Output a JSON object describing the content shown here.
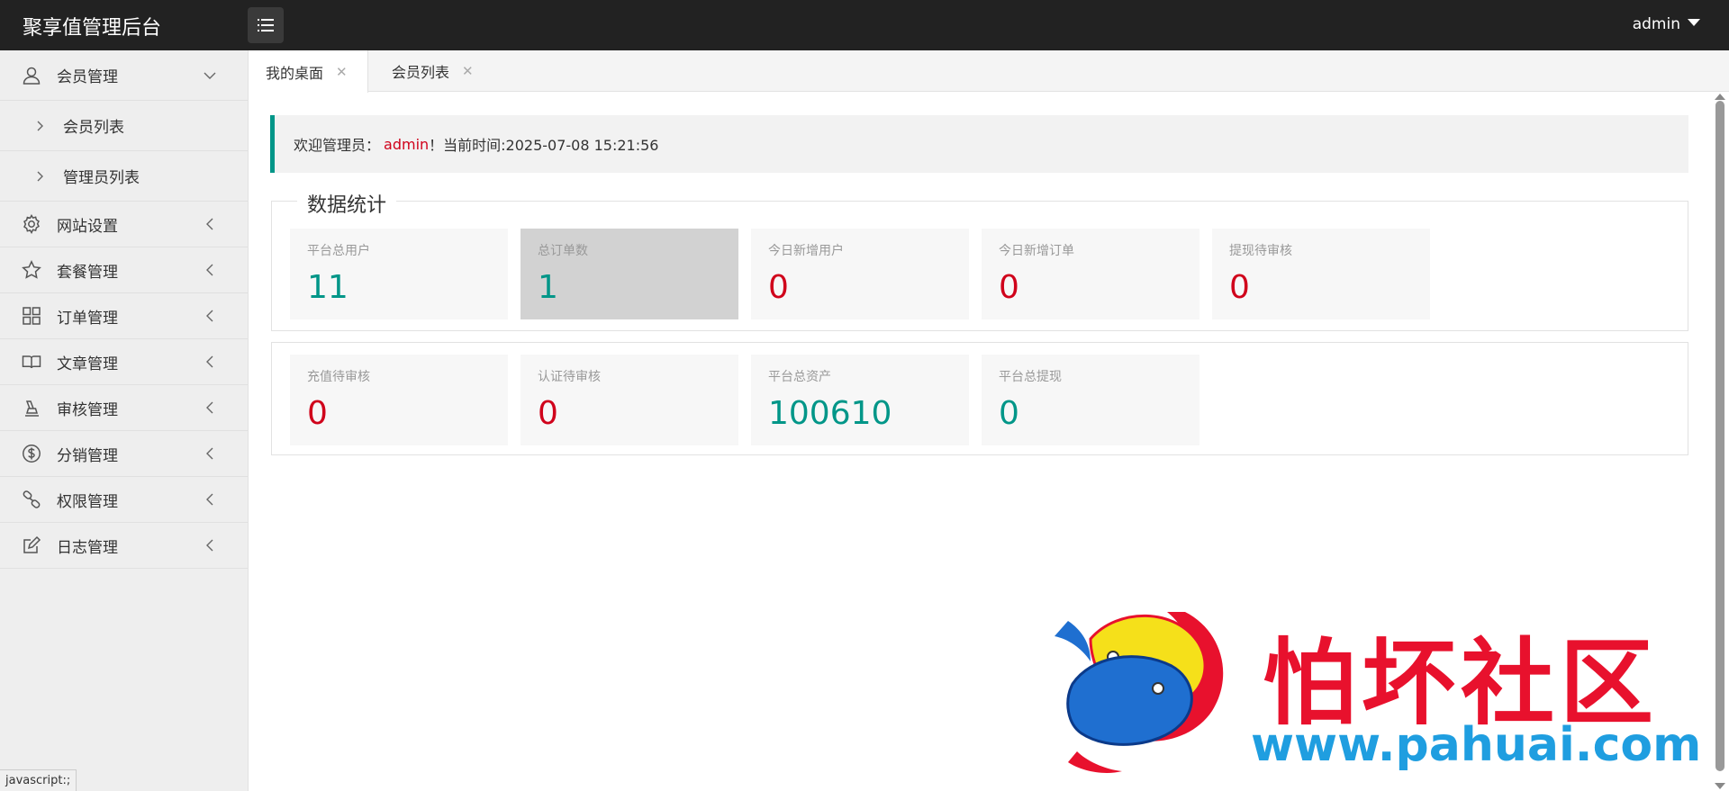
{
  "app": {
    "title": "聚享值管理后台",
    "user": "admin"
  },
  "sidebar": {
    "groups": [
      {
        "label": "会员管理",
        "icon": "user-icon",
        "expanded": true,
        "children": [
          {
            "label": "会员列表"
          },
          {
            "label": "管理员列表"
          }
        ]
      },
      {
        "label": "网站设置",
        "icon": "gear-icon"
      },
      {
        "label": "套餐管理",
        "icon": "star-icon"
      },
      {
        "label": "订单管理",
        "icon": "grid-icon"
      },
      {
        "label": "文章管理",
        "icon": "book-icon"
      },
      {
        "label": "审核管理",
        "icon": "stamp-icon"
      },
      {
        "label": "分销管理",
        "icon": "dollar-icon"
      },
      {
        "label": "权限管理",
        "icon": "link-icon"
      },
      {
        "label": "日志管理",
        "icon": "edit-icon"
      }
    ]
  },
  "tabs": [
    {
      "label": "我的桌面",
      "active": true,
      "close": "✕"
    },
    {
      "label": "会员列表",
      "active": false,
      "close": "✕"
    }
  ],
  "welcome": {
    "prefix": "欢迎管理员：",
    "admin": "admin",
    "suffix": "！当前时间:2025-07-08 15:21:56"
  },
  "stats": {
    "legend": "数据统计",
    "row1": [
      {
        "title": "平台总用户",
        "value": "11",
        "color": "#009688"
      },
      {
        "title": "总订单数",
        "value": "1",
        "color": "#009688"
      },
      {
        "title": "今日新增用户",
        "value": "0",
        "color": "#d0021b"
      },
      {
        "title": "今日新增订单",
        "value": "0",
        "color": "#d0021b"
      },
      {
        "title": "提现待审核",
        "value": "0",
        "color": "#d0021b"
      }
    ],
    "row2": [
      {
        "title": "充值待审核",
        "value": "0",
        "color": "#d0021b"
      },
      {
        "title": "认证待审核",
        "value": "0",
        "color": "#d0021b"
      },
      {
        "title": "平台总资产",
        "value": "100610",
        "color": "#009688"
      },
      {
        "title": "平台总提现",
        "value": "0",
        "color": "#009688"
      }
    ]
  },
  "status_bar": {
    "text": "javascript:;"
  },
  "watermark": {
    "text": "怕坏社区",
    "url": "www.pahuai.com"
  },
  "colors": {
    "accent": "#009688",
    "danger": "#d0021b",
    "topbar": "#222222"
  }
}
